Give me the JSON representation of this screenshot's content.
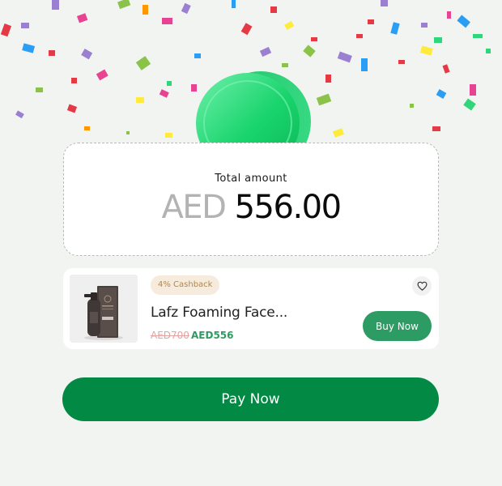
{
  "summary": {
    "label": "Total  amount",
    "currency": "AED",
    "amount": "556.00"
  },
  "product": {
    "cashback": "4% Cashback",
    "name": "Lafz Foaming Face...",
    "price_old": "AED700",
    "price_new": "AED556",
    "buy_label": "Buy Now",
    "wishlist_icon": "heart-outline-icon"
  },
  "actions": {
    "pay_label": "Pay Now"
  },
  "colors": {
    "primary": "#028a44",
    "buy": "#2c9b64",
    "coin": "#2fd67a"
  }
}
